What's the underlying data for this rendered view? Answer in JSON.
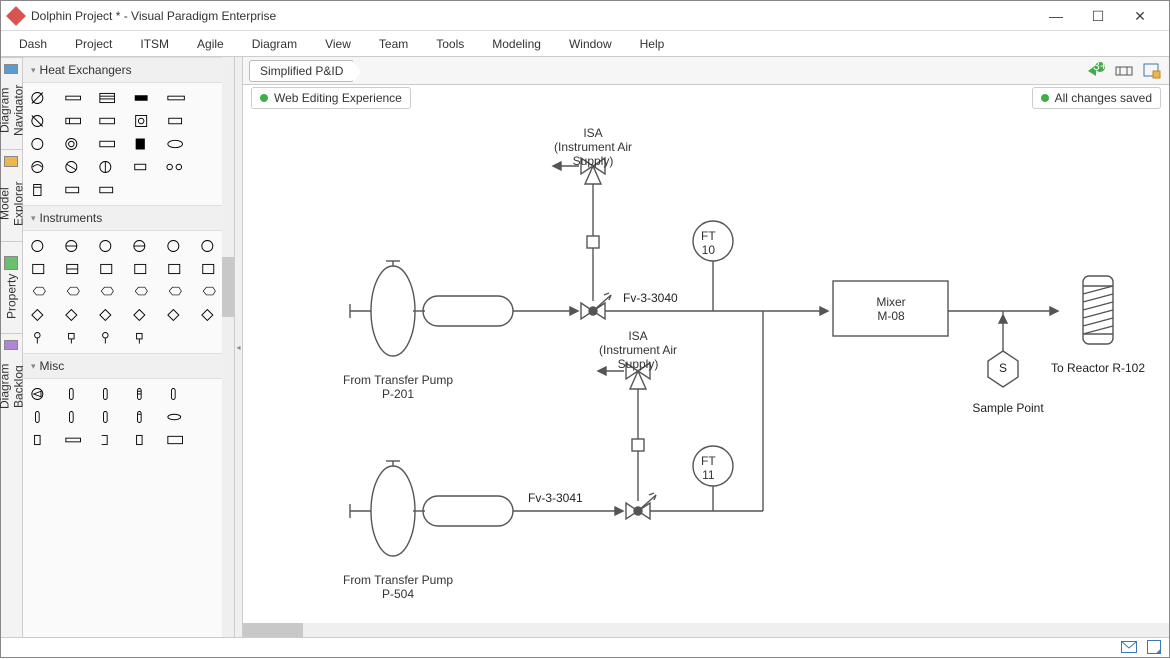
{
  "window": {
    "title": "Dolphin Project * - Visual Paradigm Enterprise"
  },
  "menubar": [
    "Dash",
    "Project",
    "ITSM",
    "Agile",
    "Diagram",
    "View",
    "Team",
    "Tools",
    "Modeling",
    "Window",
    "Help"
  ],
  "sidetabs": [
    "Diagram Navigator",
    "Model Explorer",
    "Property",
    "Diagram Backlog"
  ],
  "palette": {
    "sections": [
      "Heat Exchangers",
      "Instruments",
      "Misc"
    ]
  },
  "diagram": {
    "tab": "Simplified P&ID",
    "status_left": "Web Editing Experience",
    "status_right": "All changes saved",
    "labels": {
      "isa1_a": "ISA",
      "isa1_b": "(Instrument Air Supply)",
      "isa2_a": "ISA",
      "isa2_b": "(Instrument Air Supply)",
      "ft10_a": "FT",
      "ft10_b": "10",
      "ft11_a": "FT",
      "ft11_b": "11",
      "fv1": "Fv-3-3040",
      "fv2": "Fv-3-3041",
      "pump1_a": "From Transfer Pump",
      "pump1_b": "P-201",
      "pump2_a": "From Transfer Pump",
      "pump2_b": "P-504",
      "mixer_a": "Mixer",
      "mixer_b": "M-08",
      "sample_s": "S",
      "sample": "Sample Point",
      "reactor": "To Reactor R-102"
    }
  },
  "notif_badge": "3+"
}
